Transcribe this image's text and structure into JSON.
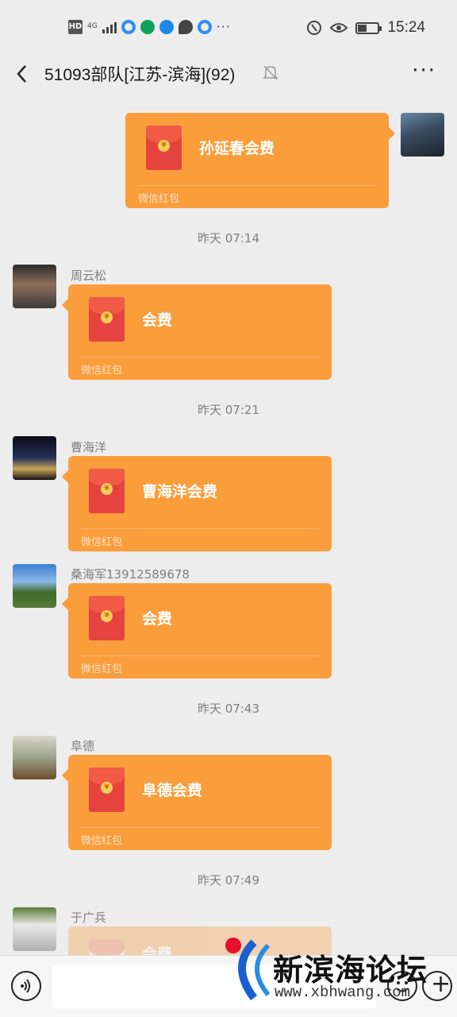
{
  "status_bar": {
    "hd": "HD",
    "signal": "4G",
    "icons": [
      "chrome-blue-icon",
      "china-mobile-icon",
      "telegram-icon",
      "message-bubble-icon",
      "browser-icon"
    ],
    "more": "···",
    "time": "15:24"
  },
  "header": {
    "title": "51093部队[江苏-滨海](92)",
    "more": "···",
    "icons": [
      "back-chevron-icon",
      "mute-bell-icon"
    ]
  },
  "messages": [
    {
      "type": "red_packet",
      "direction": "out",
      "title": "孙延春会费",
      "footer": "微信红包"
    },
    {
      "type": "timestamp",
      "text": "昨天 07:14"
    },
    {
      "type": "red_packet",
      "direction": "in",
      "sender": "周云松",
      "title": "会费",
      "footer": "微信红包"
    },
    {
      "type": "timestamp",
      "text": "昨天 07:21"
    },
    {
      "type": "red_packet",
      "direction": "in",
      "sender": "曹海洋",
      "title": "曹海洋会费",
      "footer": "微信红包"
    },
    {
      "type": "red_packet",
      "direction": "in",
      "sender": "桑海军13912589678",
      "title": "会费",
      "footer": "微信红包"
    },
    {
      "type": "timestamp",
      "text": "昨天 07:43"
    },
    {
      "type": "red_packet",
      "direction": "in",
      "sender": "阜德",
      "title": "阜德会费",
      "footer": "微信红包"
    },
    {
      "type": "timestamp",
      "text": "昨天 07:49"
    },
    {
      "type": "red_packet",
      "direction": "in",
      "sender": "于广兵",
      "title": "会费",
      "footer": ""
    }
  ],
  "input_bar": {
    "icons": [
      "voice-icon",
      "emoji-icon",
      "plus-icon"
    ]
  },
  "watermark": {
    "name": "新滨海论坛",
    "url": "www.xbhwang.com"
  },
  "colors": {
    "background": "#ededed",
    "red_packet": "#fa9d3b",
    "envelope": "#e64340"
  }
}
